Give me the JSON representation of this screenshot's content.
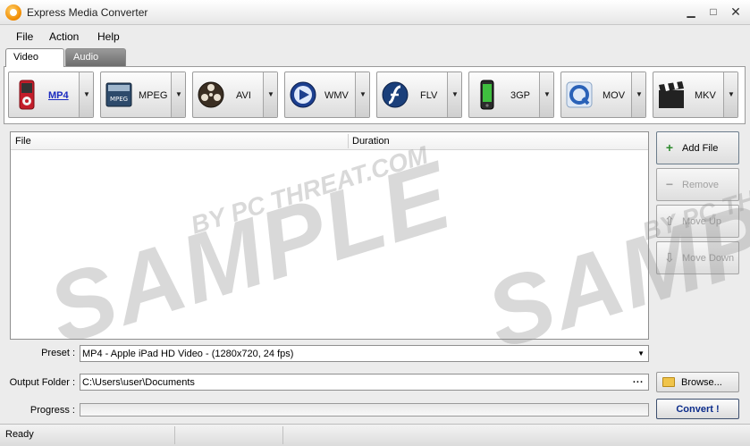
{
  "window": {
    "title": "Express Media Converter"
  },
  "menu": [
    "File",
    "Action",
    "Help"
  ],
  "tabs": [
    {
      "label": "Video",
      "active": true
    },
    {
      "label": "Audio",
      "active": false
    }
  ],
  "formats": [
    {
      "label": "MP4",
      "icon": "ipod-icon",
      "active": true
    },
    {
      "label": "MPEG",
      "icon": "mpeg-icon"
    },
    {
      "label": "AVI",
      "icon": "film-reel-icon"
    },
    {
      "label": "WMV",
      "icon": "windows-media-icon"
    },
    {
      "label": "FLV",
      "icon": "flash-icon"
    },
    {
      "label": "3GP",
      "icon": "phone-icon"
    },
    {
      "label": "MOV",
      "icon": "quicktime-icon"
    },
    {
      "label": "MKV",
      "icon": "clapperboard-icon"
    }
  ],
  "file_list": {
    "columns": [
      "File",
      "Duration"
    ],
    "rows": []
  },
  "side_buttons": [
    {
      "label": "Add File",
      "enabled": true,
      "icon": "plus-icon"
    },
    {
      "label": "Remove",
      "enabled": false,
      "icon": "minus-icon"
    },
    {
      "label": "Move Up",
      "enabled": false,
      "icon": "arrow-up-icon"
    },
    {
      "label": "Move Down",
      "enabled": false,
      "icon": "arrow-down-icon"
    }
  ],
  "preset": {
    "label": "Preset :",
    "value": "MP4 - Apple iPad HD Video - (1280x720, 24 fps)"
  },
  "output_folder": {
    "label": "Output Folder :",
    "value": "C:\\Users\\user\\Documents",
    "browse_dots": "..."
  },
  "browse_label": "Browse...",
  "progress": {
    "label": "Progress :",
    "value": 0
  },
  "convert_label": "Convert !",
  "status": {
    "text": "Ready"
  },
  "watermark": {
    "big": "SAMPLE",
    "small": "BY PC THREAT.COM"
  }
}
